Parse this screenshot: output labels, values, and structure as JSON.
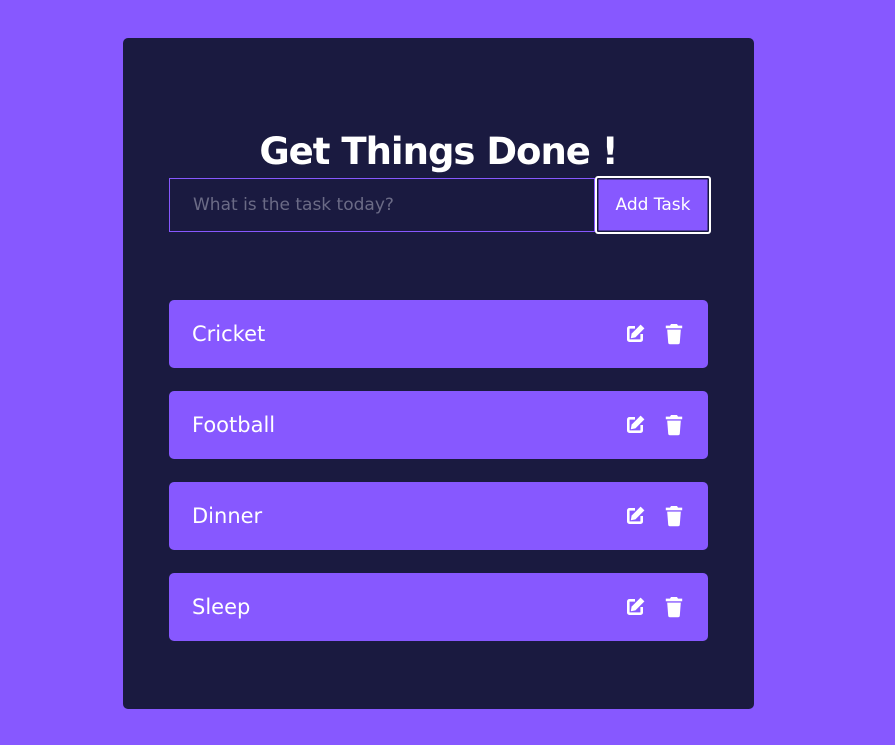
{
  "header": {
    "title": "Get Things Done !"
  },
  "form": {
    "placeholder": "What is the task today?",
    "value": "",
    "add_button_label": "Add Task"
  },
  "todos": [
    {
      "label": "Cricket",
      "edit_icon": "edit-icon",
      "delete_icon": "trash-icon"
    },
    {
      "label": "Football",
      "edit_icon": "edit-icon",
      "delete_icon": "trash-icon"
    },
    {
      "label": "Dinner",
      "edit_icon": "edit-icon",
      "delete_icon": "trash-icon"
    },
    {
      "label": "Sleep",
      "edit_icon": "edit-icon",
      "delete_icon": "trash-icon"
    }
  ],
  "colors": {
    "background": "#8758ff",
    "card": "#1a1a40",
    "item": "#8758ff",
    "text": "#ffffff",
    "placeholder": "#6b6b86"
  }
}
